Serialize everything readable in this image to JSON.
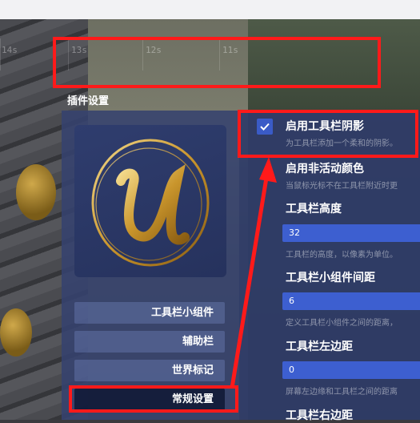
{
  "timeline": {
    "ticks": [
      "14s",
      "13s",
      "12s",
      "11s"
    ]
  },
  "panel": {
    "title": "插件设置"
  },
  "sidebar": {
    "items": [
      {
        "label": "工具栏小组件",
        "active": false
      },
      {
        "label": "辅助栏",
        "active": false
      },
      {
        "label": "世界标记",
        "active": false
      },
      {
        "label": "常规设置",
        "active": true
      }
    ]
  },
  "settings": {
    "shadow": {
      "title": "启用工具栏阴影",
      "desc": "为工具栏添加一个柔和的阴影。",
      "checked": true
    },
    "inactive_color": {
      "title": "启用非活动颜色",
      "desc": "当鼠标光标不在工具栏附近时更"
    },
    "height": {
      "title": "工具栏高度",
      "value": "32",
      "desc": "工具栏的高度，以像素为单位。"
    },
    "widget_spacing": {
      "title": "工具栏小组件间距",
      "value": "6",
      "desc": "定义工具栏小组件之间的距离，"
    },
    "left_margin": {
      "title": "工具栏左边距",
      "value": "0",
      "desc": "屏幕左边缘和工具栏之间的距离"
    },
    "right_margin": {
      "title": "工具栏右边距"
    }
  },
  "colors": {
    "annotation": "#ff1a1a",
    "accent": "#3d5fd0",
    "panel": "#36426e"
  }
}
